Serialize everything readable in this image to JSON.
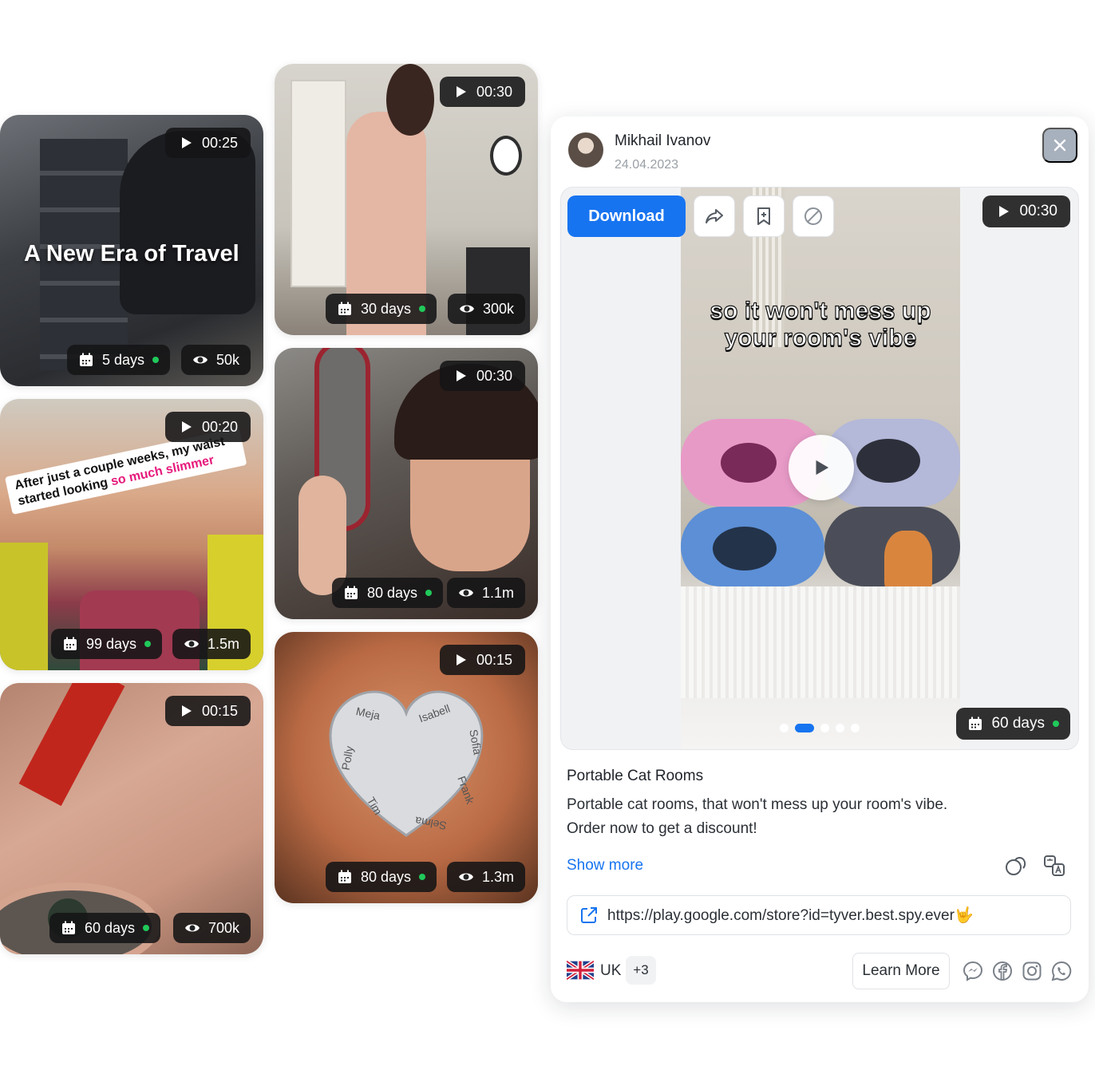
{
  "cards": [
    {
      "duration": "00:25",
      "days": "5 days",
      "views": "50k",
      "overlay": "A New Era of Travel"
    },
    {
      "duration": "00:20",
      "days": "99 days",
      "views": "1.5m",
      "overlay_line1": "After just a couple weeks, my waist",
      "overlay_line2a": "started looking ",
      "overlay_line2b": "so much slimmer"
    },
    {
      "duration": "00:15",
      "days": "60 days",
      "views": "700k"
    },
    {
      "duration": "00:30",
      "days": "30 days",
      "views": "300k"
    },
    {
      "duration": "00:30",
      "days": "80 days",
      "views": "1.1m"
    },
    {
      "duration": "00:15",
      "days": "80 days",
      "views": "1.3m",
      "names": [
        "Meja",
        "Isabell",
        "Polly",
        "Sofia",
        "Tim",
        "Frank",
        "Selma"
      ]
    }
  ],
  "details": {
    "author": "Mikhail Ivanov",
    "date": "24.04.2023",
    "download_label": "Download",
    "duration": "00:30",
    "days": "60 days",
    "caption_line1": "so it won't mess up",
    "caption_line2": "your room's vibe",
    "title": "Portable Cat Rooms",
    "text_line1": "Portable cat rooms, that won't mess up your room's vibe.",
    "text_line2": "Order now to get a discount!",
    "show_more": "Show more",
    "url": "https://play.google.com/store?id=tyver.best.spy.ever🤟",
    "country": "UK",
    "more_countries": "+3",
    "cta": "Learn More",
    "accent": "#1774f0",
    "status_dot": "#20c95a"
  }
}
